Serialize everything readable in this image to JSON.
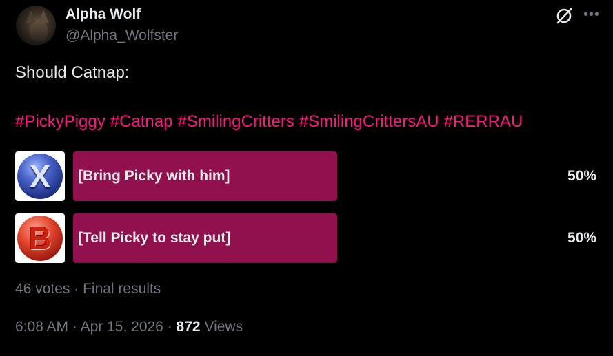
{
  "author": {
    "name": "Alpha Wolf",
    "handle": "@Alpha_Wolfster"
  },
  "tweet": {
    "text": "Should Catnap:",
    "hashtags": [
      "#PickyPiggy",
      "#Catnap",
      "#SmilingCritters",
      "#SmilingCrittersAU",
      "#RERRAU"
    ]
  },
  "poll": {
    "options": [
      {
        "thumb_letter": "X",
        "label": "[Bring Picky with him]",
        "percent": "50%"
      },
      {
        "thumb_letter": "B",
        "label": "[Tell Picky to stay put]",
        "percent": "50%"
      }
    ],
    "votes": "46 votes",
    "separator": "·",
    "status": "Final results"
  },
  "meta": {
    "time": "6:08 AM",
    "date": "Apr 15, 2026",
    "views_count": "872",
    "views_label": "Views"
  },
  "icons": {
    "grok": "grok-icon",
    "more": "more-icon"
  },
  "colors": {
    "background": "#000000",
    "text": "#e7e9ea",
    "secondary": "#71767b",
    "hashtag": "#f91880",
    "poll_bar": "#91104e"
  }
}
